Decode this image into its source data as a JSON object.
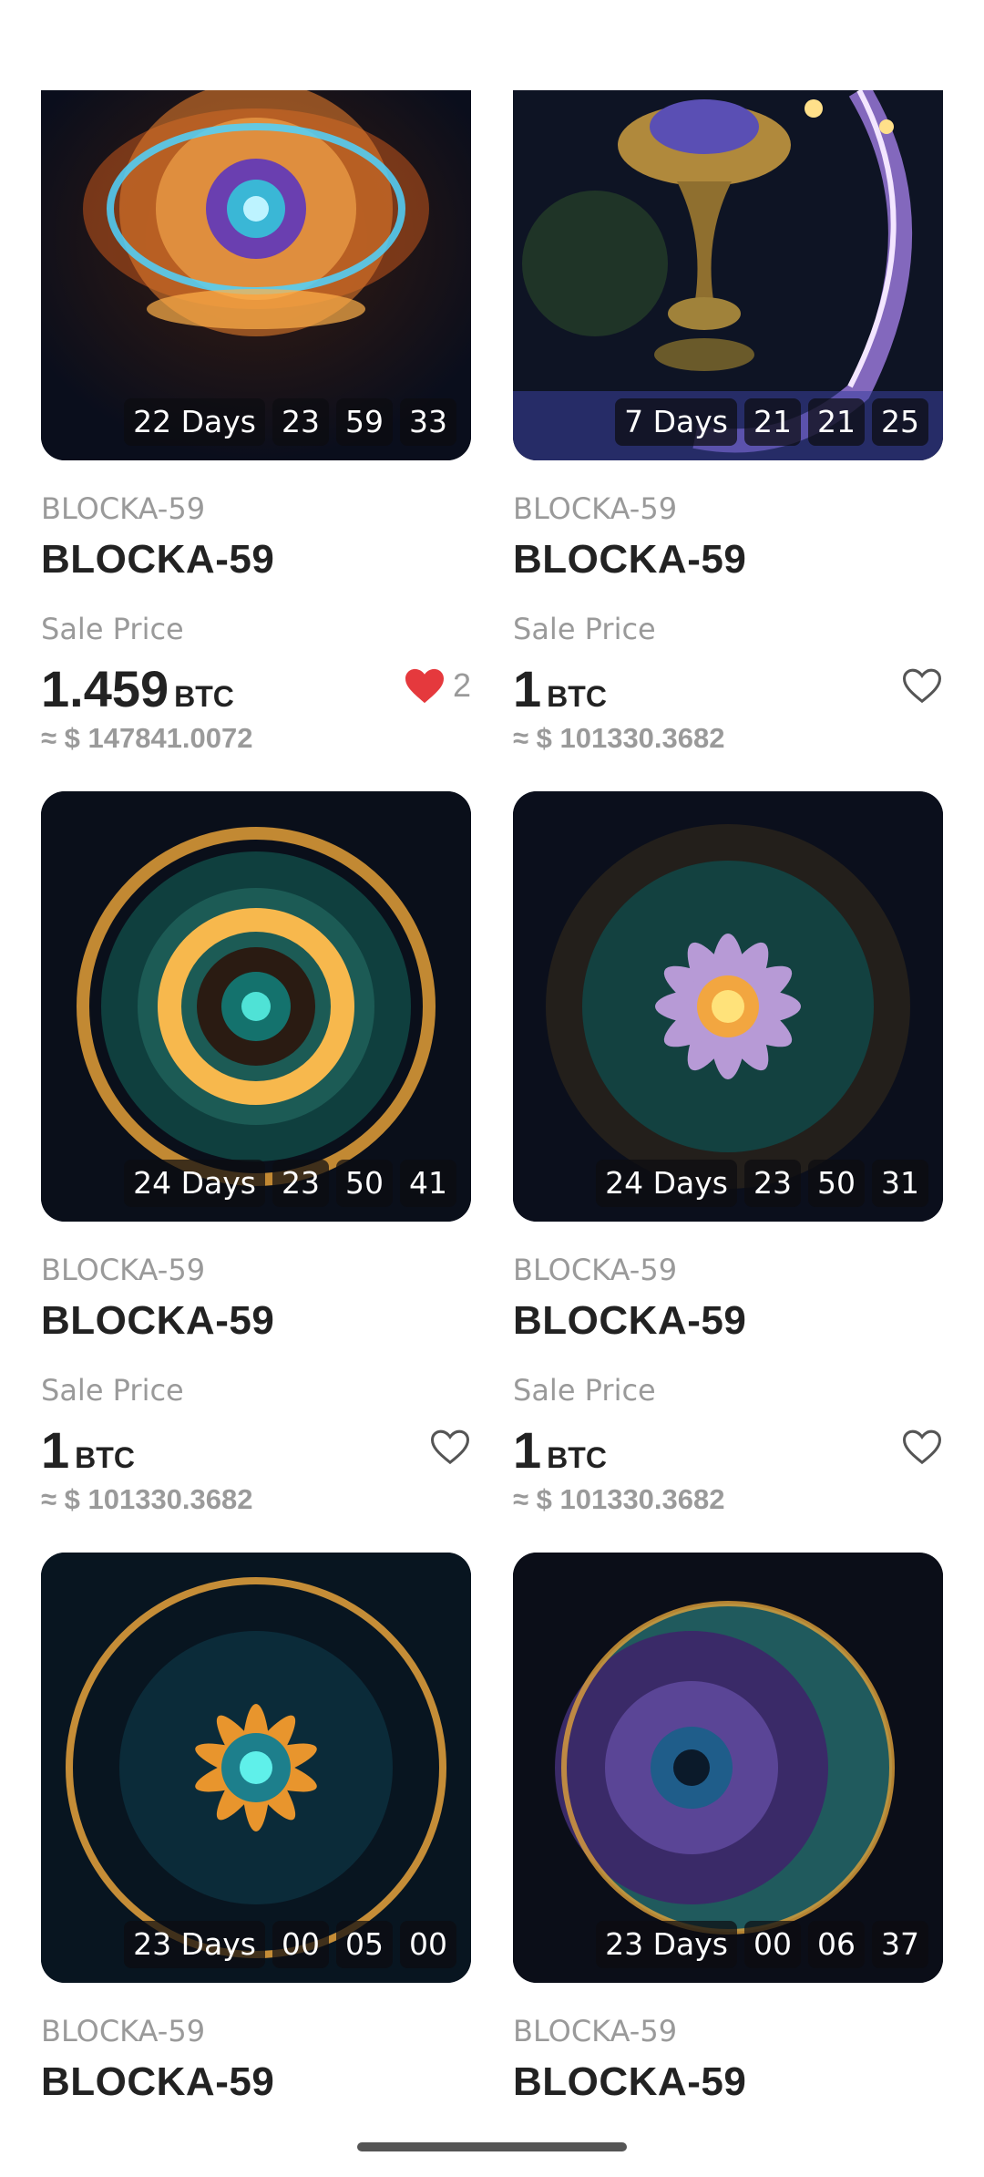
{
  "currency_unit": "BTC",
  "colors": {
    "liked": "#e5393d",
    "unliked_outline": "#555555"
  },
  "cards": [
    {
      "collection": "BLOCKA-59",
      "name": "BLOCKA-59",
      "sale_label": "Sale Price",
      "price": "1.459",
      "unit": "BTC",
      "fiat": "≈ $ 147841.0072",
      "liked": true,
      "likes": "2",
      "timer": {
        "days": "22 Days",
        "hours": "23",
        "minutes": "59",
        "seconds": "33"
      },
      "art": "orange-lotus"
    },
    {
      "collection": "BLOCKA-59",
      "name": "BLOCKA-59",
      "sale_label": "Sale Price",
      "price": "1",
      "unit": "BTC",
      "fiat": "≈ $ 101330.3682",
      "liked": false,
      "likes": "",
      "timer": {
        "days": "7 Days",
        "hours": "21",
        "minutes": "21",
        "seconds": "25"
      },
      "art": "golden-chalice"
    },
    {
      "collection": "BLOCKA-59",
      "name": "BLOCKA-59",
      "sale_label": "Sale Price",
      "price": "1",
      "unit": "BTC",
      "fiat": "≈ $ 101330.3682",
      "liked": false,
      "likes": "",
      "timer": {
        "days": "24 Days",
        "hours": "23",
        "minutes": "50",
        "seconds": "41"
      },
      "art": "teal-mandala"
    },
    {
      "collection": "BLOCKA-59",
      "name": "BLOCKA-59",
      "sale_label": "Sale Price",
      "price": "1",
      "unit": "BTC",
      "fiat": "≈ $ 101330.3682",
      "liked": false,
      "likes": "",
      "timer": {
        "days": "24 Days",
        "hours": "23",
        "minutes": "50",
        "seconds": "31"
      },
      "art": "purple-flower"
    },
    {
      "collection": "BLOCKA-59",
      "name": "BLOCKA-59",
      "timer": {
        "days": "23 Days",
        "hours": "00",
        "minutes": "05",
        "seconds": "00"
      },
      "art": "sun-ring"
    },
    {
      "collection": "BLOCKA-59",
      "name": "BLOCKA-59",
      "timer": {
        "days": "23 Days",
        "hours": "00",
        "minutes": "06",
        "seconds": "37"
      },
      "art": "floral-sphere"
    }
  ]
}
